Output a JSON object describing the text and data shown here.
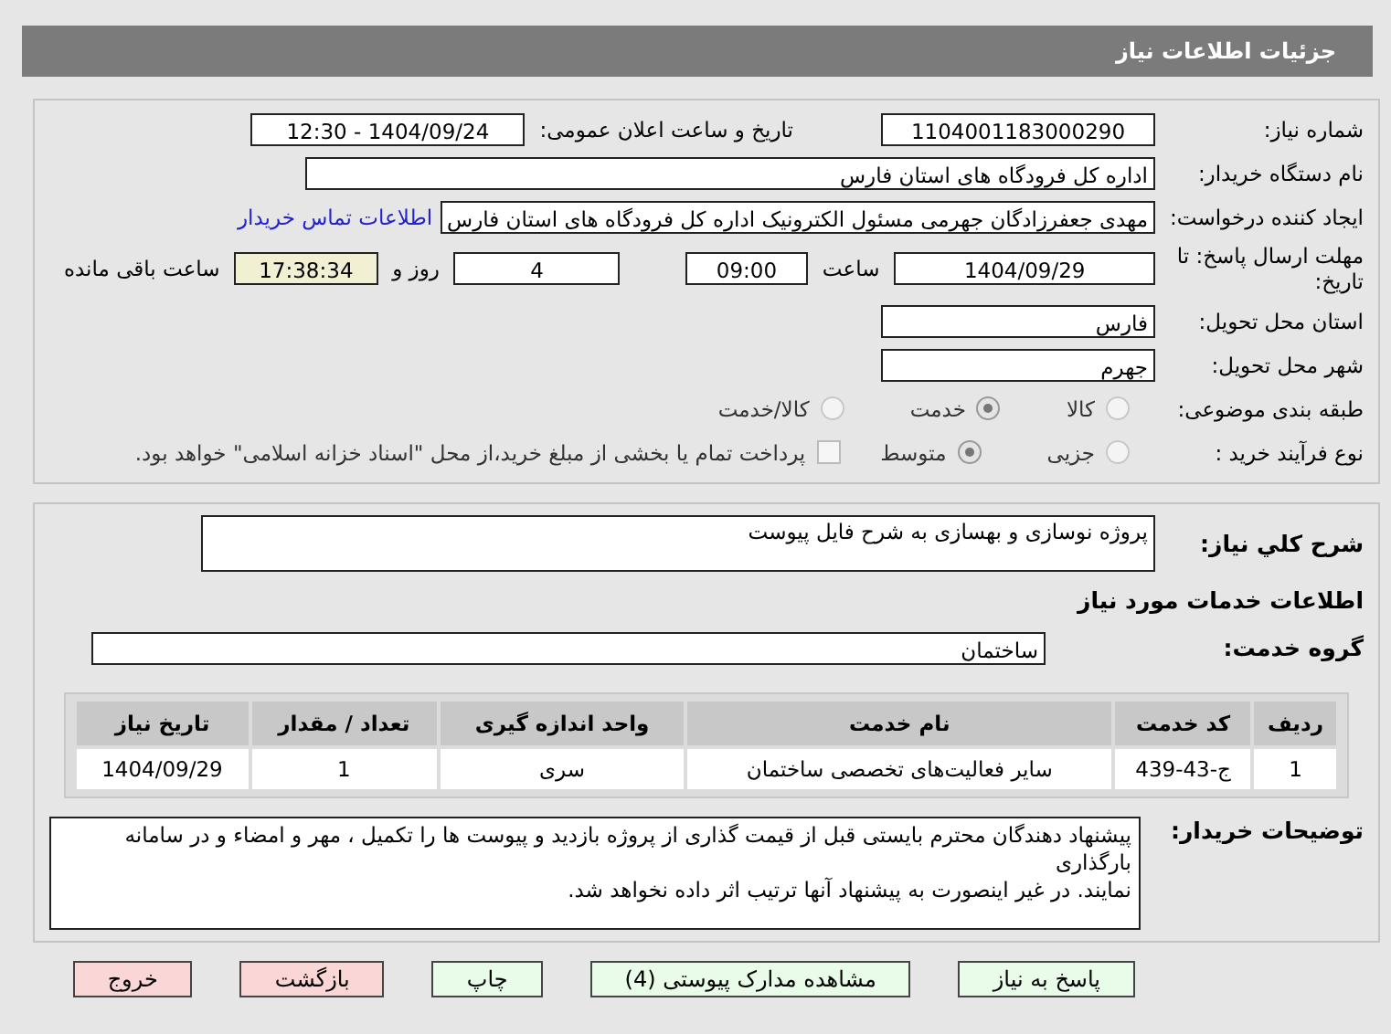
{
  "header": {
    "title": "جزئیات اطلاعات نیاز"
  },
  "need_number": {
    "label": "شماره نیاز:",
    "value": "1104001183000290"
  },
  "announce": {
    "label": "تاریخ و ساعت اعلان عمومی:",
    "value": "1404/09/24 - 12:30"
  },
  "buyer_org": {
    "label": "نام دستگاه خریدار:",
    "value": "اداره کل فرودگاه های استان فارس"
  },
  "requester": {
    "label": "ایجاد کننده درخواست:",
    "value": "مهدی جعفرزادگان جهرمی مسئول الکترونیک اداره کل فرودگاه های استان فارس",
    "link": "اطلاعات تماس خریدار"
  },
  "deadline": {
    "label": "مهلت ارسال پاسخ: تا تاریخ:",
    "date": "1404/09/29",
    "time_label": "ساعت",
    "time": "09:00",
    "days": "4",
    "days_label": "روز و",
    "remaining": "17:38:34",
    "remaining_label": "ساعت باقی مانده"
  },
  "province": {
    "label": "استان محل تحویل:",
    "value": "فارس"
  },
  "city": {
    "label": "شهر محل تحویل:",
    "value": "جهرم"
  },
  "category": {
    "label": "طبقه بندی موضوعی:",
    "options": [
      {
        "label": "کالا",
        "selected": false
      },
      {
        "label": "خدمت",
        "selected": true
      },
      {
        "label": "کالا/خدمت",
        "selected": false
      }
    ]
  },
  "purchase_type": {
    "label": "نوع فرآیند خرید :",
    "options": [
      {
        "label": "جزیی",
        "selected": false
      },
      {
        "label": "متوسط",
        "selected": true
      }
    ],
    "checkbox": {
      "label": "پرداخت تمام یا بخشی از مبلغ خرید،از محل \"اسناد خزانه اسلامی\" خواهد بود.",
      "checked": false
    }
  },
  "description": {
    "label": "شرح کلي نياز:",
    "value": "پروژه نوسازی و بهسازی  به شرح فایل پیوست"
  },
  "services_heading": "اطلاعات خدمات مورد نیاز",
  "service_group": {
    "label": "گروه خدمت:",
    "value": "ساختمان"
  },
  "table": {
    "columns": [
      "ردیف",
      "کد خدمت",
      "نام خدمت",
      "واحد اندازه گیری",
      "تعداد / مقدار",
      "تاریخ نیاز"
    ],
    "rows": [
      [
        "1",
        "ج-43-439",
        "سایر فعالیت‌های تخصصی ساختمان",
        "سری",
        "1",
        "1404/09/29"
      ]
    ]
  },
  "buyer_notes": {
    "label": "توضیحات خریدار:",
    "lines": [
      "پیشنهاد دهندگان محترم بایستی قبل از قیمت گذاری از پروژه بازدید و  پیوست ها را تکمیل ، مهر و امضاء و در سامانه بارگذاری",
      "نمایند. در غیر اینصورت به پیشنهاد آنها ترتیب اثر داده نخواهد شد."
    ]
  },
  "buttons": [
    {
      "label": "پاسخ به نیاز",
      "kind": "action"
    },
    {
      "label": "مشاهده مدارک پیوستی (4)",
      "kind": "action"
    },
    {
      "label": "چاپ",
      "kind": "action"
    },
    {
      "label": "بازگشت",
      "kind": "danger"
    },
    {
      "label": "خروج",
      "kind": "danger"
    }
  ]
}
